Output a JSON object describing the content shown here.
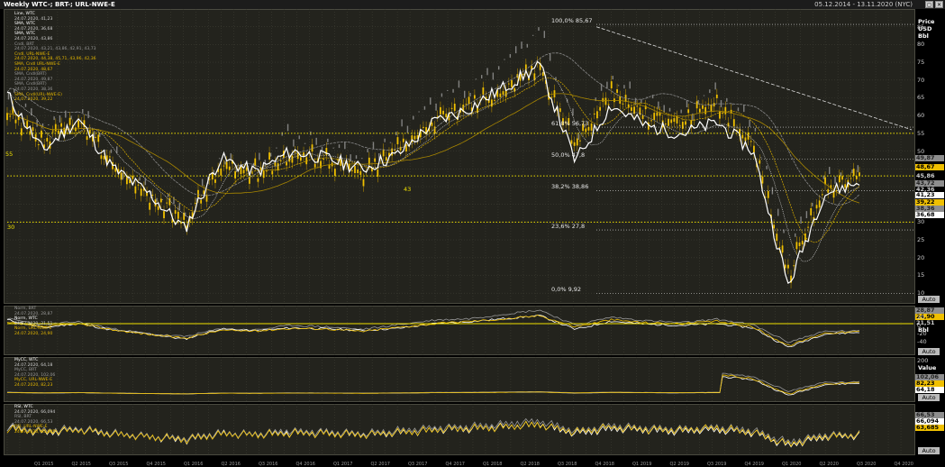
{
  "window": {
    "title": "Weekly WTC-; BRT-; URL-NWE-E",
    "date_range": "05.12.2014 - 13.11.2020 (NYC)"
  },
  "price_axis": {
    "label_1": "Price",
    "label_2": "USD",
    "label_3": "Bbl",
    "ticks": [
      "85",
      "80",
      "75",
      "70",
      "65",
      "60",
      "55",
      "50",
      "45",
      "40",
      "35",
      "30",
      "25",
      "20",
      "15",
      "10"
    ],
    "auto_label": "Auto",
    "last_values": [
      {
        "text": "49,87",
        "bg": "#8e8e8e",
        "fg": "#222"
      },
      {
        "text": "48,67",
        "bg": "#f0c000",
        "fg": "#000"
      },
      {
        "text": "45,86",
        "bg": "#000",
        "fg": "#cfcfcf"
      },
      {
        "text": "43,72",
        "bg": "#8e8e8e",
        "fg": "#222"
      },
      {
        "text": "42,36",
        "bg": "#000",
        "fg": "#cfcfcf"
      },
      {
        "text": "41,23",
        "bg": "#fff",
        "fg": "#000"
      },
      {
        "text": "39,22",
        "bg": "#f0c000",
        "fg": "#000"
      },
      {
        "text": "38,36",
        "bg": "#8e8e8e",
        "fg": "#222"
      },
      {
        "text": "36,68",
        "bg": "#fff",
        "fg": "#000"
      }
    ]
  },
  "price_legend": [
    {
      "text": "Line, WTC",
      "color": "#ffffff"
    },
    {
      "text": "24.07.2020, 41,23",
      "color": "#cfcfcf"
    },
    {
      "text": "SMA, WTC",
      "color": "#ffffff"
    },
    {
      "text": "24.07.2020, 36,68",
      "color": "#cfcfcf"
    },
    {
      "text": "SMA, WTC",
      "color": "#ffffff"
    },
    {
      "text": "24.07.2020, 43,86",
      "color": "#cfcfcf"
    },
    {
      "text": "Cndl, BRT",
      "color": "#999999"
    },
    {
      "text": "24.07.2020, 43,21, 43,86, 42,91, 43,73",
      "color": "#999999"
    },
    {
      "text": "Cndl, URL-NWE-E",
      "color": "#e6b800"
    },
    {
      "text": "24.07.2020, 44,38, 45,71, 43,96, 42,36",
      "color": "#e6b800"
    },
    {
      "text": "SMA, Cndl URL-NWE-E",
      "color": "#e6b800"
    },
    {
      "text": "24.07.2020, 48,67",
      "color": "#e6b800"
    },
    {
      "text": "SMA, Cndl(BRT)",
      "color": "#999999"
    },
    {
      "text": "24.07.2020, 49,87",
      "color": "#999999"
    },
    {
      "text": "SMA, Cndl(BRT)",
      "color": "#999999"
    },
    {
      "text": "24.07.2020, 38,36",
      "color": "#999999"
    },
    {
      "text": "SMA, Cndl(URL-NWE-E)",
      "color": "#e6b800"
    },
    {
      "text": "24.07.2020, 39,22",
      "color": "#e6b800"
    }
  ],
  "fibonacci": [
    {
      "label": "100,0% 85,67",
      "value": 85.67
    },
    {
      "label": "61,8%   56,73",
      "value": 56.73
    },
    {
      "label": "50,0%   47,8",
      "value": 47.8
    },
    {
      "label": "38,2%   38,86",
      "value": 38.86
    },
    {
      "label": "23,6%   27,8",
      "value": 27.8
    },
    {
      "label": "0,0%    9,92",
      "value": 9.92
    }
  ],
  "level_labels": {
    "left_55": "55",
    "left_30": "30",
    "mid_43": "43"
  },
  "norm_panel": {
    "unit": "Bbl",
    "ticks": [
      "20",
      "0",
      "-20",
      "-40"
    ],
    "auto_label": "Auto",
    "last_values": [
      {
        "text": "28,87",
        "bg": "#8e8e8e",
        "fg": "#222"
      },
      {
        "text": "24,90",
        "bg": "#f0c000",
        "fg": "#000"
      },
      {
        "text": "21,51",
        "bg": "#000",
        "fg": "#cfcfcf"
      }
    ],
    "legend": [
      {
        "text": "Norm, BRT",
        "color": "#999999"
      },
      {
        "text": "24.07.2020, 28,87",
        "color": "#999999"
      },
      {
        "text": "Norm, WTC",
        "color": "#ffffff"
      },
      {
        "text": "24.07.2020, 21,51",
        "color": "#cfcfcf"
      },
      {
        "text": "Norm, URL-NWE-E",
        "color": "#e6b800"
      },
      {
        "text": "24.07.2020, 24,90",
        "color": "#e6b800"
      }
    ]
  },
  "mycc_panel": {
    "unit": "Value",
    "ticks": [
      "200"
    ],
    "auto_label": "Auto",
    "last_values": [
      {
        "text": "102,06",
        "bg": "#8e8e8e",
        "fg": "#222"
      },
      {
        "text": "82,23",
        "bg": "#f0c000",
        "fg": "#000"
      },
      {
        "text": "64,18",
        "bg": "#fff",
        "fg": "#000"
      }
    ],
    "legend": [
      {
        "text": "MyCC, WTC",
        "color": "#ffffff"
      },
      {
        "text": "24.07.2020, 64,18",
        "color": "#cfcfcf"
      },
      {
        "text": "MyCC, BRT",
        "color": "#999999"
      },
      {
        "text": "24.07.2020, 102,06",
        "color": "#999999"
      },
      {
        "text": "MyCC, URL-NWE-E",
        "color": "#e6b800"
      },
      {
        "text": "24.07.2020, 82,23",
        "color": "#e6b800"
      }
    ]
  },
  "rsi_panel": {
    "auto_label": "Auto",
    "last_values": [
      {
        "text": "66,53",
        "bg": "#8e8e8e",
        "fg": "#222"
      },
      {
        "text": "66,094",
        "bg": "#fff",
        "fg": "#000"
      },
      {
        "text": "63,685",
        "bg": "#f0c000",
        "fg": "#000"
      }
    ],
    "legend": [
      {
        "text": "RSI, WTC",
        "color": "#ffffff"
      },
      {
        "text": "24.07.2020, 66,094",
        "color": "#cfcfcf"
      },
      {
        "text": "RSI, BRT",
        "color": "#999999"
      },
      {
        "text": "24.07.2020, 66,53",
        "color": "#999999"
      },
      {
        "text": "RSI, URL-NWE-E",
        "color": "#e6b800"
      },
      {
        "text": "24.07.2020, 63,685",
        "color": "#e6b800"
      }
    ]
  },
  "colors": {
    "wtc": "#ffffff",
    "brt": "#9a9a9a",
    "url": "#f0c000",
    "grid": "#3e3e34",
    "fib": "#e0e0e0",
    "level": "#f0e000"
  },
  "chart_data": {
    "type": "line",
    "title": "Weekly WTC-; BRT-; URL-NWE-E",
    "x": [
      "2014-12",
      "2015-03",
      "2015-06",
      "2015-09",
      "2015-12",
      "2016-02",
      "2016-06",
      "2016-09",
      "2016-12",
      "2017-03",
      "2017-06",
      "2017-09",
      "2017-12",
      "2018-03",
      "2018-06",
      "2018-10",
      "2018-12",
      "2019-04",
      "2019-07",
      "2019-10",
      "2019-12",
      "2020-02",
      "2020-04",
      "2020-06",
      "2020-07"
    ],
    "xlim": [
      "2014-12",
      "2020-11"
    ],
    "ylim": [
      9,
      90
    ],
    "series": [
      {
        "name": "WTC",
        "values": [
          66,
          50,
          59,
          45,
          38,
          28,
          48,
          44,
          50,
          48,
          45,
          49,
          58,
          62,
          68,
          74,
          47,
          63,
          57,
          55,
          58,
          50,
          12,
          38,
          41.23
        ]
      },
      {
        "name": "BRT",
        "values": [
          68,
          56,
          62,
          48,
          38,
          33,
          48,
          46,
          55,
          52,
          47,
          56,
          65,
          68,
          77,
          85,
          55,
          71,
          64,
          60,
          67,
          56,
          22,
          43,
          43.73
        ]
      },
      {
        "name": "URL-NWE-E",
        "values": [
          60,
          52,
          58,
          46,
          37,
          30,
          45,
          44,
          49,
          48,
          43,
          51,
          58,
          63,
          67,
          74,
          52,
          66,
          60,
          58,
          63,
          52,
          15,
          40,
          42.36
        ]
      }
    ],
    "x_labels": [
      "Q1 2015",
      "Q2 2015",
      "Q3 2015",
      "Q4 2015",
      "Q1 2016",
      "Q2 2016",
      "Q3 2016",
      "Q4 2016",
      "Q1 2017",
      "Q2 2017",
      "Q3 2017",
      "Q4 2017",
      "Q1 2018",
      "Q2 2018",
      "Q3 2018",
      "Q4 2018",
      "Q1 2019",
      "Q2 2019",
      "Q3 2019",
      "Q4 2019",
      "Q1 2020",
      "Q2 2020",
      "Q3 2020",
      "Q4 2020"
    ]
  }
}
